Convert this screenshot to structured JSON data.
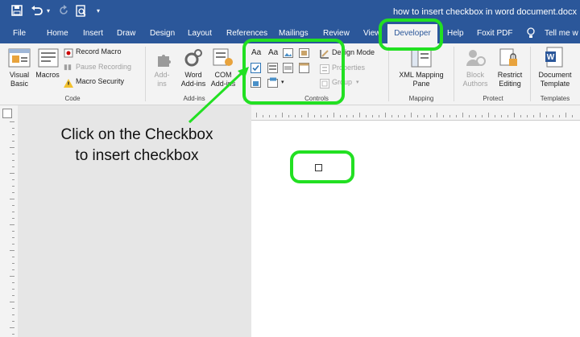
{
  "window": {
    "title": "how to insert checkbox in word document.docx"
  },
  "tabs": [
    "File",
    "Home",
    "Insert",
    "Draw",
    "Design",
    "Layout",
    "References",
    "Mailings",
    "Review",
    "View",
    "Developer",
    "Help",
    "Foxit PDF"
  ],
  "tell_me": "Tell me w",
  "ribbon": {
    "code": {
      "visual_basic_1": "Visual",
      "visual_basic_2": "Basic",
      "macros": "Macros",
      "record_macro": "Record Macro",
      "pause_recording": "Pause Recording",
      "macro_security": "Macro Security",
      "group": "Code"
    },
    "addins": {
      "addins_1": "Add-",
      "addins_2": "ins",
      "word_addins_1": "Word",
      "word_addins_2": "Add-ins",
      "com_addins_1": "COM",
      "com_addins_2": "Add-ins",
      "group": "Add-ins"
    },
    "controls": {
      "aa1": "Aa",
      "aa2": "Aa",
      "design_mode": "Design Mode",
      "properties": "Properties",
      "group_btn": "Group",
      "group": "Controls"
    },
    "mapping": {
      "xml_1": "XML Mapping",
      "xml_2": "Pane",
      "group": "Mapping"
    },
    "protect": {
      "block_1": "Block",
      "block_2": "Authors",
      "restrict_1": "Restrict",
      "restrict_2": "Editing",
      "group": "Protect"
    },
    "templates": {
      "doc_1": "Document",
      "doc_2": "Template",
      "group": "Templates"
    }
  },
  "annotation": {
    "line1": "Click on the Checkbox",
    "line2": "to insert checkbox"
  },
  "colors": {
    "word_blue": "#2b579a",
    "highlight": "#22e022",
    "checkbox_accent": "#2e75b6"
  },
  "icons": [
    "save-icon",
    "undo-icon",
    "redo-icon",
    "print-preview-icon",
    "lightbulb-icon",
    "checkbox-icon"
  ]
}
